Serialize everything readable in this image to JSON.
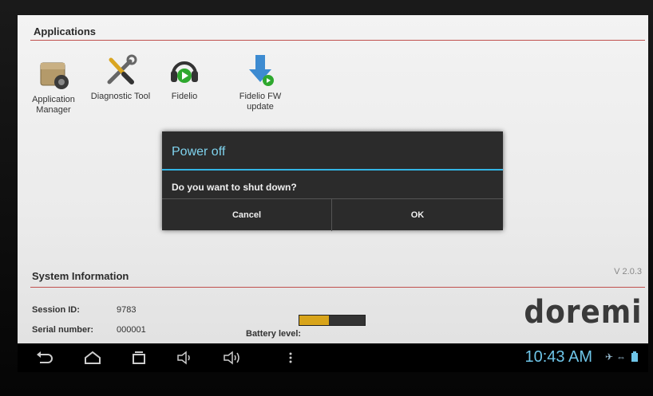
{
  "applications": {
    "title": "Applications",
    "apps": [
      {
        "label": "Application Manager",
        "icon": "app-manager-icon"
      },
      {
        "label": "Diagnostic Tool",
        "icon": "wrench-screwdriver-icon"
      },
      {
        "label": "Fidelio",
        "icon": "headphones-icon"
      },
      {
        "label": "Fidelio FW update",
        "icon": "download-arrow-icon"
      }
    ]
  },
  "dialog": {
    "title": "Power off",
    "message": "Do you want to shut down?",
    "cancel_label": "Cancel",
    "ok_label": "OK"
  },
  "system_info": {
    "title": "System Information",
    "version": "V 2.0.3",
    "session_label": "Session ID:",
    "session_value": "9783",
    "serial_label": "Serial number:",
    "serial_value": "000001",
    "battery_label": "Battery level:",
    "battery_level": 0.45,
    "logo": "doremi"
  },
  "statusbar": {
    "clock": "10:43 AM",
    "accent": "#33b5e5"
  },
  "colors": {
    "rule": "#c0504d",
    "battery": "#d8a41a"
  }
}
